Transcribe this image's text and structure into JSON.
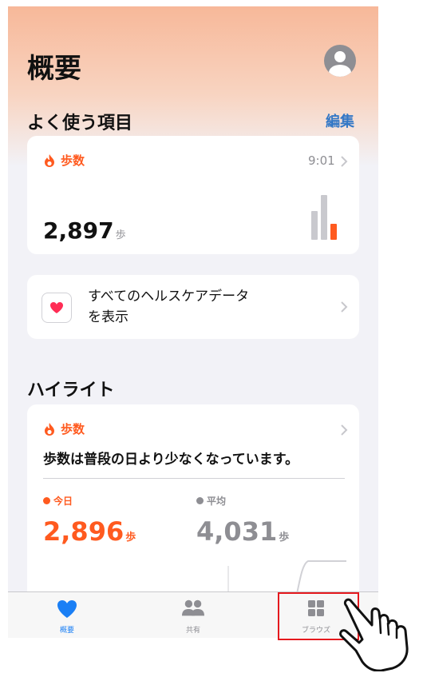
{
  "header": {
    "title": "概要"
  },
  "favorites": {
    "title": "よく使う項目",
    "edit_label": "編集",
    "steps_card": {
      "label": "歩数",
      "time": "9:01",
      "value": "2,897",
      "unit": "歩"
    },
    "health_data_card": {
      "line1": "すべてのヘルスケアデータ",
      "line2": "を表示"
    }
  },
  "highlights": {
    "title": "ハイライト",
    "card": {
      "label": "歩数",
      "message": "歩数は普段の日より少なくなっています。",
      "today_label": "今日",
      "today_value": "2,896",
      "today_unit": "歩",
      "avg_label": "平均",
      "avg_value": "4,031",
      "avg_unit": "歩"
    }
  },
  "tab_bar": {
    "tabs": [
      {
        "label": "概要",
        "icon": "heart-icon",
        "active": true
      },
      {
        "label": "共有",
        "icon": "people-icon",
        "active": false
      },
      {
        "label": "ブラウズ",
        "icon": "grid-icon",
        "active": false
      }
    ]
  },
  "colors": {
    "accent_orange": "#ff5a1f",
    "link_blue": "#3478c6",
    "tab_active": "#1a7ff5",
    "inactive_gray": "#8e8e93",
    "annotation_red": "#e5191e"
  }
}
